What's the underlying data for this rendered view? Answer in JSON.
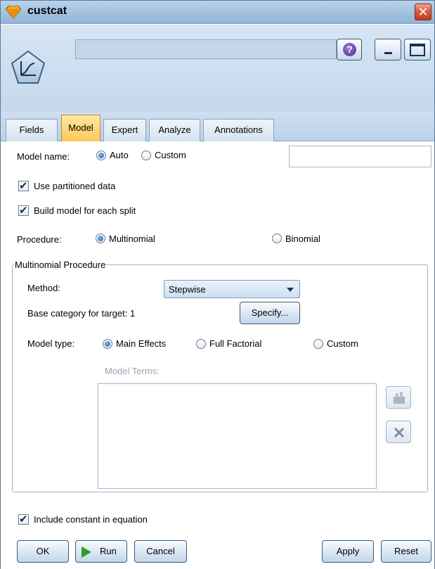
{
  "window": {
    "title": "custcat",
    "close_glyph": "✕"
  },
  "header": {
    "node_name": "",
    "help_glyph": "?"
  },
  "tabs": [
    {
      "label": "Fields",
      "active": false
    },
    {
      "label": "Model",
      "active": true
    },
    {
      "label": "Expert",
      "active": false
    },
    {
      "label": "Analyze",
      "active": false
    },
    {
      "label": "Annotations",
      "active": false
    }
  ],
  "model": {
    "model_name_label": "Model name:",
    "auto_label": "Auto",
    "custom_label": "Custom",
    "model_name_selected": "Auto",
    "custom_name_value": "",
    "use_partitioned_label": "Use partitioned data",
    "use_partitioned_checked": true,
    "build_each_split_label": "Build model for each split",
    "build_each_split_checked": true,
    "procedure_label": "Procedure:",
    "multinomial_label": "Multinomial",
    "binomial_label": "Binomial",
    "procedure_selected": "Multinomial"
  },
  "multinomial": {
    "group_label": "Multinomial Procedure",
    "method_label": "Method:",
    "method_value": "Stepwise",
    "base_category_label": "Base category for target: 1",
    "specify_label": "Specify...",
    "model_type_label": "Model type:",
    "main_effects_label": "Main Effects",
    "full_factorial_label": "Full Factorial",
    "custom_label": "Custom",
    "model_type_selected": "Main Effects",
    "model_terms_label": "Model Terms:",
    "model_terms": []
  },
  "include_constant_label": "Include constant in equation",
  "include_constant_checked": true,
  "buttons": {
    "ok": "OK",
    "run": "Run",
    "cancel": "Cancel",
    "apply": "Apply",
    "reset": "Reset"
  },
  "colors": {
    "active_tab": "#ffc85a",
    "titlebar": "#a3c1df",
    "run_icon": "#2aa02a"
  },
  "icons": {
    "window": "node-diamond-icon",
    "node": "logistic-curve-icon",
    "help": "help-icon",
    "minimize": "minimize-icon",
    "maximize": "maximize-icon",
    "add_term": "add-term-icon",
    "delete_term": "delete-x-icon"
  }
}
